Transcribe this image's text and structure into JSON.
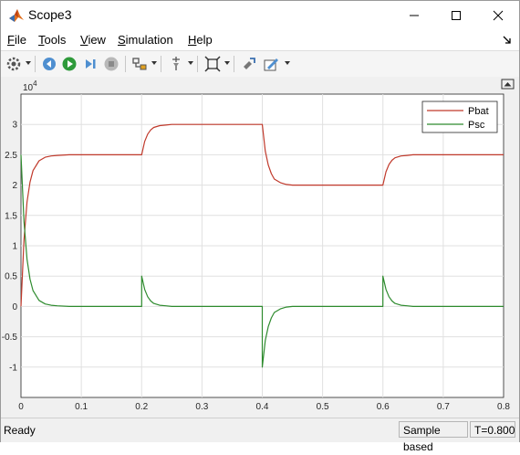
{
  "window": {
    "title": "Scope3",
    "minimize_icon": "minimize-icon",
    "maximize_icon": "maximize-icon",
    "close_icon": "close-icon"
  },
  "menu": {
    "items": [
      {
        "label": "File",
        "key": "F",
        "rest": "ile"
      },
      {
        "label": "Tools",
        "key": "T",
        "rest": "ools"
      },
      {
        "label": "View",
        "key": "V",
        "rest": "iew"
      },
      {
        "label": "Simulation",
        "key": "S",
        "rest": "imulation"
      },
      {
        "label": "Help",
        "key": "H",
        "rest": "elp"
      }
    ]
  },
  "toolbar": {
    "icons": [
      "settings-icon",
      "step-back-icon",
      "run-icon",
      "step-forward-icon",
      "stop-icon",
      "highlight-icon",
      "cursor-measure-icon",
      "zoom-fit-icon",
      "write-data-icon",
      "style-icon"
    ]
  },
  "statusbar": {
    "status": "Ready",
    "mode": "Sample based",
    "time": "T=0.800"
  },
  "colors": {
    "pbat": "#c0392b",
    "psc": "#2e8b2e",
    "grid": "#e0e0e0"
  },
  "chart_data": {
    "type": "line",
    "exponent_label": "10",
    "exponent_power": "4",
    "xlim": [
      0,
      0.8
    ],
    "ylim": [
      -1.5,
      3.5
    ],
    "xticks": [
      "0",
      "0.1",
      "0.2",
      "0.3",
      "0.4",
      "0.5",
      "0.6",
      "0.7",
      "0.8"
    ],
    "yticks": [
      "-1",
      "-0.5",
      "0",
      "0.5",
      "1",
      "1.5",
      "2",
      "2.5",
      "3"
    ],
    "grid": true,
    "legend_position": "top-right",
    "series": [
      {
        "name": "Pbat",
        "x": [
          0,
          0.005,
          0.01,
          0.015,
          0.02,
          0.03,
          0.04,
          0.05,
          0.06,
          0.08,
          0.1,
          0.2,
          0.205,
          0.21,
          0.215,
          0.22,
          0.23,
          0.24,
          0.25,
          0.27,
          0.3,
          0.4,
          0.405,
          0.41,
          0.415,
          0.42,
          0.43,
          0.44,
          0.45,
          0.47,
          0.5,
          0.6,
          0.605,
          0.61,
          0.615,
          0.62,
          0.63,
          0.64,
          0.65,
          0.67,
          0.7,
          0.8
        ],
        "y": [
          0,
          1.1,
          1.72,
          2.05,
          2.24,
          2.4,
          2.46,
          2.48,
          2.49,
          2.5,
          2.5,
          2.5,
          2.72,
          2.84,
          2.91,
          2.95,
          2.98,
          2.99,
          3.0,
          3.0,
          3.0,
          3.0,
          2.56,
          2.33,
          2.19,
          2.1,
          2.04,
          2.01,
          2.0,
          2.0,
          2.0,
          2.0,
          2.22,
          2.34,
          2.41,
          2.45,
          2.48,
          2.49,
          2.5,
          2.5,
          2.5,
          2.5
        ]
      },
      {
        "name": "Psc",
        "x": [
          0,
          0.005,
          0.01,
          0.015,
          0.02,
          0.03,
          0.04,
          0.05,
          0.06,
          0.08,
          0.1,
          0.2,
          0.2,
          0.205,
          0.21,
          0.215,
          0.22,
          0.23,
          0.24,
          0.25,
          0.27,
          0.3,
          0.4,
          0.4,
          0.405,
          0.41,
          0.415,
          0.42,
          0.43,
          0.44,
          0.45,
          0.47,
          0.5,
          0.6,
          0.6,
          0.605,
          0.61,
          0.615,
          0.62,
          0.63,
          0.64,
          0.65,
          0.67,
          0.7,
          0.8
        ],
        "y": [
          2.5,
          1.4,
          0.78,
          0.45,
          0.26,
          0.1,
          0.04,
          0.02,
          0.01,
          0,
          0,
          0,
          0.5,
          0.28,
          0.16,
          0.09,
          0.05,
          0.02,
          0.01,
          0,
          0,
          0,
          0,
          -1.0,
          -0.56,
          -0.33,
          -0.19,
          -0.1,
          -0.04,
          -0.01,
          0,
          0,
          0,
          0,
          0.5,
          0.28,
          0.16,
          0.09,
          0.05,
          0.02,
          0.01,
          0,
          0,
          0,
          0
        ]
      }
    ]
  }
}
